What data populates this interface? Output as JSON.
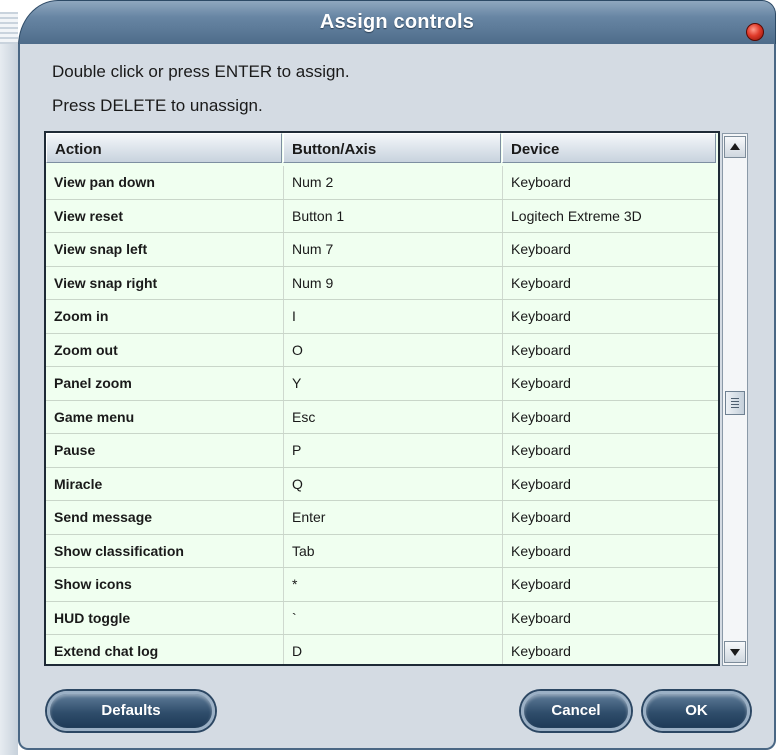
{
  "window": {
    "title": "Assign controls",
    "accent_color": "#4c6a88",
    "close_icon": "close-icon"
  },
  "instructions": {
    "line1": "Double click or press ENTER to assign.",
    "line2": "Press DELETE to unassign."
  },
  "table": {
    "columns": [
      "Action",
      "Button/Axis",
      "Device"
    ],
    "rows": [
      {
        "action": "View pan down",
        "button": "Num 2",
        "device": "Keyboard"
      },
      {
        "action": "View reset",
        "button": "Button 1",
        "device": "Logitech Extreme 3D"
      },
      {
        "action": "View snap left",
        "button": "Num 7",
        "device": "Keyboard"
      },
      {
        "action": "View snap right",
        "button": "Num 9",
        "device": "Keyboard"
      },
      {
        "action": "Zoom in",
        "button": "I",
        "device": "Keyboard"
      },
      {
        "action": "Zoom out",
        "button": "O",
        "device": "Keyboard"
      },
      {
        "action": "Panel zoom",
        "button": "Y",
        "device": "Keyboard"
      },
      {
        "action": "Game menu",
        "button": "Esc",
        "device": "Keyboard"
      },
      {
        "action": "Pause",
        "button": "P",
        "device": "Keyboard"
      },
      {
        "action": "Miracle",
        "button": "Q",
        "device": "Keyboard"
      },
      {
        "action": "Send message",
        "button": "Enter",
        "device": "Keyboard"
      },
      {
        "action": "Show classification",
        "button": "Tab",
        "device": "Keyboard"
      },
      {
        "action": "Show icons",
        "button": "*",
        "device": "Keyboard"
      },
      {
        "action": "HUD toggle",
        "button": "`",
        "device": "Keyboard"
      },
      {
        "action": "Extend chat log",
        "button": "D",
        "device": "Keyboard"
      }
    ]
  },
  "scrollbar": {
    "position": 0.5
  },
  "buttons": {
    "defaults": "Defaults",
    "cancel": "Cancel",
    "ok": "OK"
  }
}
